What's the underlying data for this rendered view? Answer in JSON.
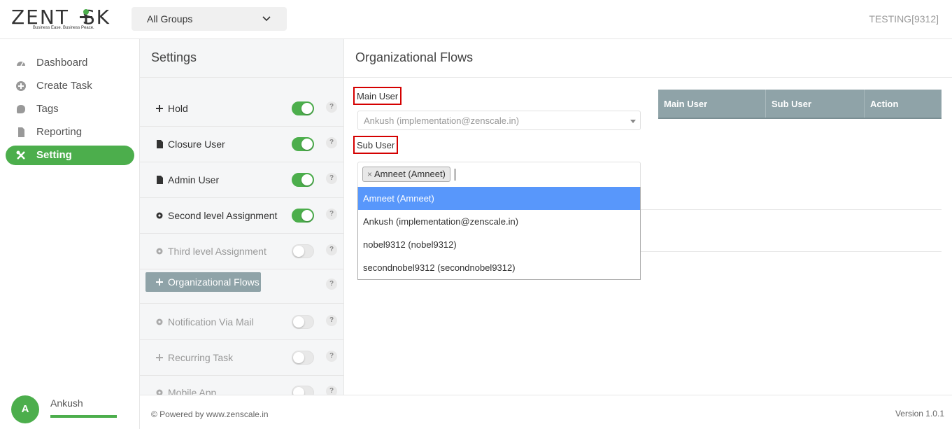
{
  "header": {
    "logo_text": "ZENTASK",
    "logo_tagline": "Business Ease. Business Peace.",
    "group_select_value": "All Groups",
    "tenant_label": "TESTING[9312]"
  },
  "nav": {
    "items": [
      {
        "label": "Dashboard",
        "icon": "dashboard-icon"
      },
      {
        "label": "Create Task",
        "icon": "plus-circle-icon"
      },
      {
        "label": "Tags",
        "icon": "tag-icon"
      },
      {
        "label": "Reporting",
        "icon": "file-icon"
      },
      {
        "label": "Setting",
        "icon": "tools-icon",
        "active": true
      }
    ],
    "user": {
      "initial": "A",
      "name": "Ankush"
    }
  },
  "settings": {
    "title": "Settings",
    "items": [
      {
        "label": "Hold",
        "icon": "plus-icon",
        "on": true
      },
      {
        "label": "Closure User",
        "icon": "file-icon",
        "on": true
      },
      {
        "label": "Admin User",
        "icon": "file-icon",
        "on": true
      },
      {
        "label": "Second level Assignment",
        "icon": "gear-icon",
        "on": true
      },
      {
        "label": "Third level Assignment",
        "icon": "gear-icon",
        "on": false
      },
      {
        "label": "Organizational Flows",
        "icon": "plus-icon",
        "button": true
      },
      {
        "label": "Notification Via Mail",
        "icon": "gear-icon",
        "on": false
      },
      {
        "label": "Recurring Task",
        "icon": "plus-icon",
        "on": false
      },
      {
        "label": "Mobile App",
        "icon": "gear-icon",
        "on": false
      }
    ],
    "help_glyph": "?"
  },
  "main": {
    "title": "Organizational Flows",
    "main_user_label": "Main User",
    "main_user_value": "Ankush (implementation@zenscale.in)",
    "sub_user_label": "Sub User",
    "selected_chip": "Amneet (Amneet)",
    "chip_remove": "×",
    "options": [
      "Amneet (Amneet)",
      "Ankush (implementation@zenscale.in)",
      "nobel9312 (nobel9312)",
      "secondnobel9312 (secondnobel9312)"
    ],
    "table_headers": [
      "Main User",
      "Sub User",
      "Action"
    ]
  },
  "footer": {
    "powered": "© Powered by www.zenscale.in",
    "version": "Version 1.0.1"
  },
  "colors": {
    "accent": "#4cae4c",
    "table_head": "#8fa3a8",
    "highlight": "#5897fb",
    "required_border": "#d40000"
  }
}
